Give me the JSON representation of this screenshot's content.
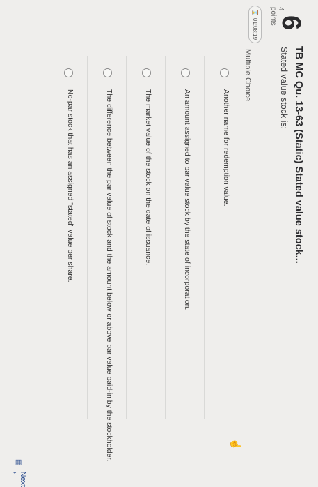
{
  "question": {
    "number": "6",
    "title": "TB MC Qu. 13-63 (Static) Stated value stock...",
    "stem": "Stated value stock is:",
    "points_value": "4",
    "points_label": "points",
    "timer": "01:08:19",
    "type_label": "Multiple Choice"
  },
  "choices": [
    {
      "label": "Another name for redemption value."
    },
    {
      "label": "An amount assigned to par value stock by the state of incorporation."
    },
    {
      "label": "The market value of the stock on the date of issuance."
    },
    {
      "label": "The difference between the par value of stock and the amount below or above par value paid-in by the stockholder."
    },
    {
      "label": "No-par stock that has an assigned \"stated\" value per share."
    }
  ],
  "nav": {
    "next_label": "Next",
    "next_icon": "chevron-right-icon",
    "grid_icon": "grid-icon"
  }
}
